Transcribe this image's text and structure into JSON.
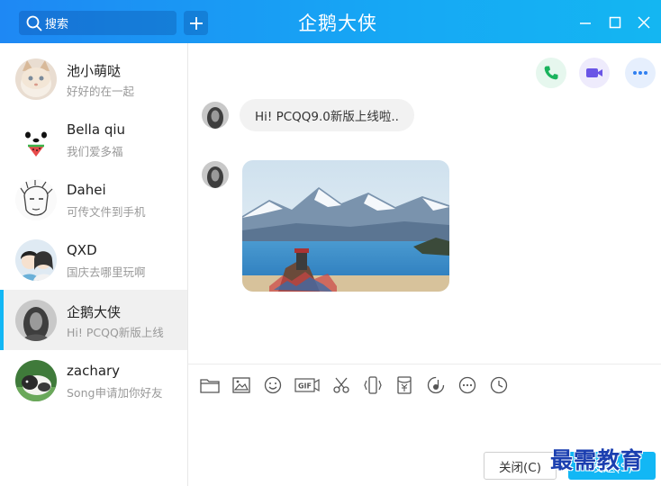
{
  "titlebar": {
    "title": "企鹅大侠",
    "search_placeholder": "搜索"
  },
  "contacts": [
    {
      "name": "池小萌哒",
      "message": "好好的在一起",
      "active": false
    },
    {
      "name": "Bella qiu",
      "message": "我们爱多福",
      "active": false
    },
    {
      "name": "Dahei",
      "message": "可传文件到手机",
      "active": false
    },
    {
      "name": "QXD",
      "message": "国庆去哪里玩啊",
      "active": false
    },
    {
      "name": "企鹅大侠",
      "message": "Hi! PCQQ新版上线",
      "active": true
    },
    {
      "name": "zachary",
      "message": "Song申请加你好友",
      "active": false
    }
  ],
  "chat": {
    "messages": [
      {
        "type": "text",
        "text": "Hi!  PCQQ9.0新版上线啦.."
      },
      {
        "type": "image",
        "content": "mountain-lake-photo"
      }
    ]
  },
  "toolbar": {
    "gif_label": "GIF",
    "icons": [
      "folder-icon",
      "image-icon",
      "emoji-icon",
      "gif-icon",
      "scissors-icon",
      "shake-icon",
      "red-packet-icon",
      "music-icon",
      "more-icon",
      "history-icon"
    ]
  },
  "buttons": {
    "close_label": "关闭(C)",
    "send_label": "发送(S)"
  },
  "watermark": "最需教育",
  "colors": {
    "accent": "#12b7f5",
    "titlebar_start": "#1e88f4",
    "call_green": "#1ab35d",
    "video_purple": "#6a55e6",
    "more_blue": "#2f7ff0"
  }
}
